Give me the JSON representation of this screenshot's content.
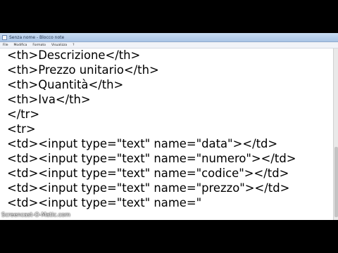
{
  "window": {
    "title": "Senza nome - Blocco note"
  },
  "menu": [
    {
      "label": "File"
    },
    {
      "label": "Modifica"
    },
    {
      "label": "Formato"
    },
    {
      "label": "Visualizza"
    },
    {
      "label": "?"
    }
  ],
  "editor": {
    "lines": [
      "<th>Descrizione</th>",
      "<th>Prezzo unitario</th>",
      "<th>Quantità</th>",
      "<th>Iva</th>",
      "</tr>",
      "<tr>",
      "<td><input type=\"text\" name=\"data\"></td>",
      "<td><input type=\"text\" name=\"numero\"></td>",
      "<td><input type=\"text\" name=\"codice\"></td>",
      "<td><input type=\"text\" name=\"prezzo\"></td>",
      "<td><input type=\"text\" name=\""
    ]
  },
  "watermark": "Screencast-O-Matic.com"
}
